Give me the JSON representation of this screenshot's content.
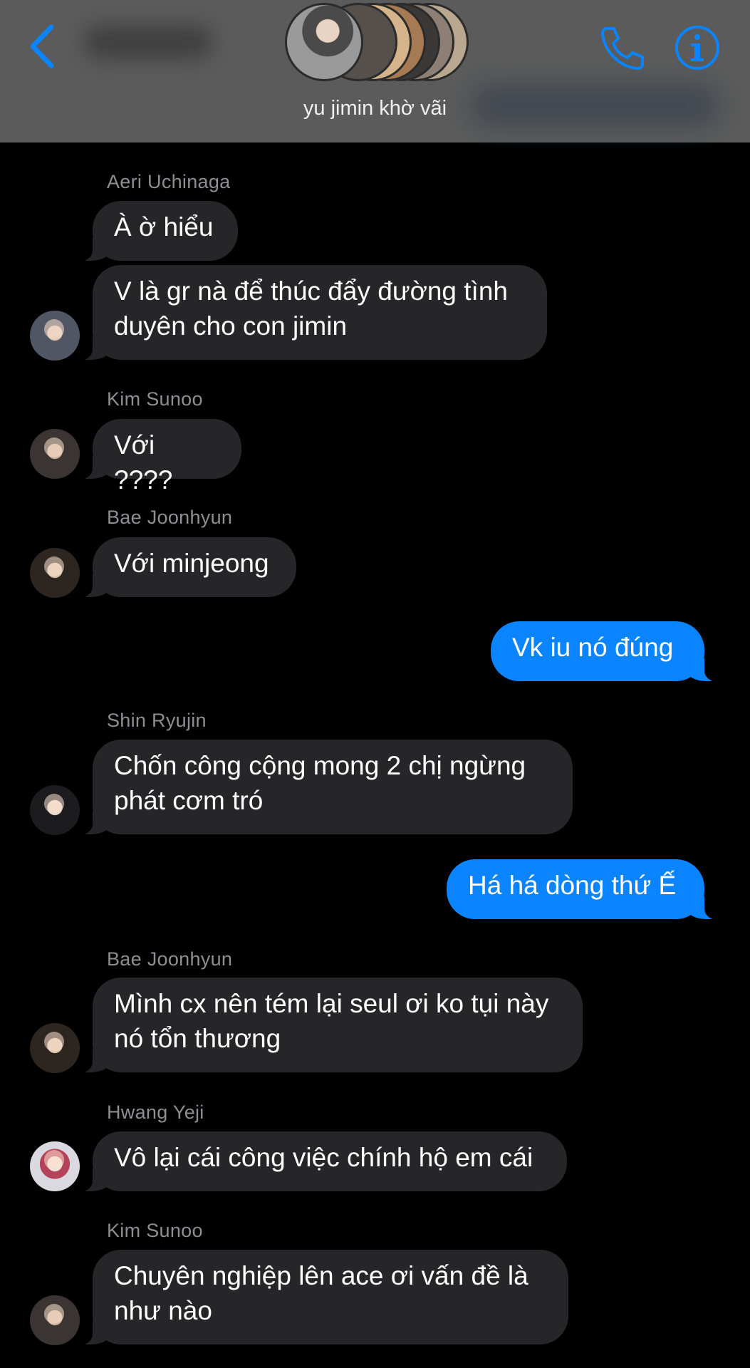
{
  "header": {
    "title": "yu jimin khờ vãi",
    "back_icon": "chevron-left-icon",
    "call_icon": "phone-icon",
    "info_icon": "info-icon",
    "accent_color": "#0a84ff"
  },
  "messages": [
    {
      "sender": "Aeri Uchinaga",
      "text": "À ờ hiểu"
    },
    {
      "text": "V là gr nà để thúc đẩy đường tình\nduyên cho con jimin"
    },
    {
      "sender": "Kim Sunoo",
      "text": "Với ????"
    },
    {
      "sender": "Bae Joonhyun",
      "text": "Với minjeong"
    },
    {
      "text": "Vk iu nó đúng"
    },
    {
      "sender": "Shin Ryujin",
      "text": "Chốn công cộng mong 2 chị ngừng\nphát cơm tró"
    },
    {
      "text": "Há há dòng thứ Ế"
    },
    {
      "sender": "Bae Joonhyun",
      "text": "Mình cx nên tém lại seul ơi ko tụi này\nnó tổn thương"
    },
    {
      "sender": "Hwang Yeji",
      "text": "Vô lại cái công việc chính hộ em cái"
    },
    {
      "sender": "Kim Sunoo",
      "text": "Chuyên nghiệp lên ace ơi vấn đề là\nnhư nào"
    }
  ]
}
